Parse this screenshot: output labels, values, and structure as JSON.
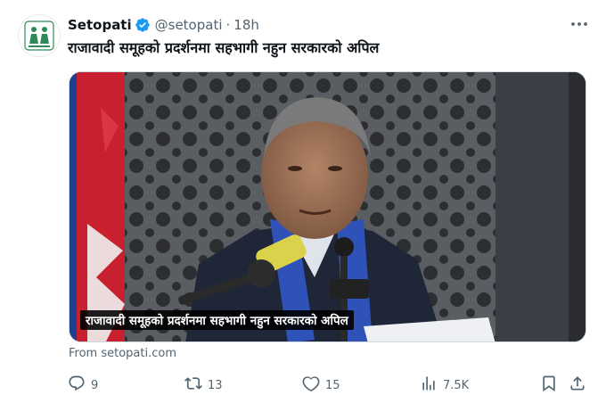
{
  "tweet": {
    "author": {
      "name": "Setopati",
      "handle": "@setopati",
      "separator": "·",
      "time": "18h",
      "avatar_icon": "setopati-logo-icon",
      "verified_color": "#1d9bf0"
    },
    "text": "राजावादी समूहको प्रदर्शनमा सहभागी नहुन सरकारको अपिल",
    "media": {
      "caption": "राजावादी समूहको प्रदर्शनमा सहभागी नहुन सरकारको अपिल",
      "description_icon": "press-conference-photo"
    },
    "source": "From setopati.com",
    "actions": {
      "reply_count": "9",
      "retweet_count": "13",
      "like_count": "15",
      "views_count": "7.5K"
    }
  },
  "colors": {
    "text": "#0f1419",
    "secondary": "#536471",
    "accent": "#1d9bf0",
    "logo_green": "#2e8b57"
  }
}
